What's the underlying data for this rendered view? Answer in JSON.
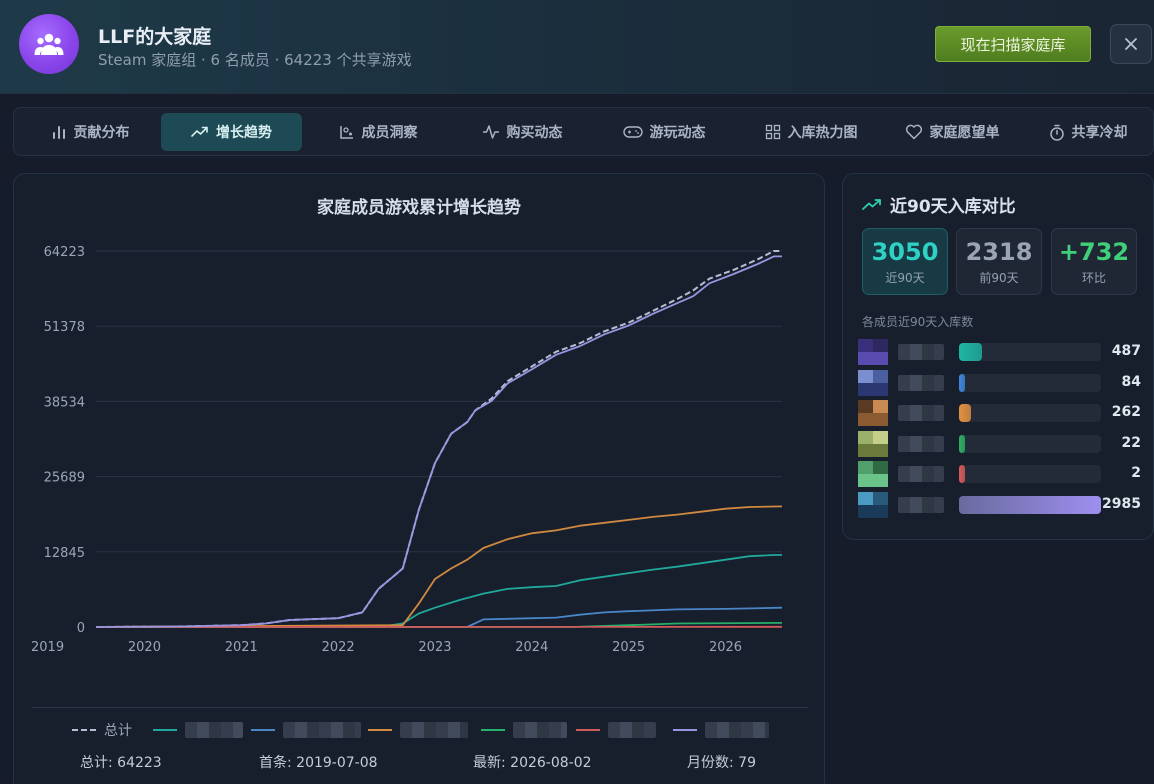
{
  "header": {
    "title": "LLF的大家庭",
    "subtitle": "Steam 家庭组 · 6 名成员 · 64223 个共享游戏",
    "scan_button": "现在扫描家庭库",
    "close_icon": "close-icon",
    "avatar_icon": "family-icon"
  },
  "tabs": [
    {
      "label": "贡献分布",
      "icon": "bar-chart-icon"
    },
    {
      "label": "增长趋势",
      "icon": "trend-up-icon",
      "active": true
    },
    {
      "label": "成员洞察",
      "icon": "scatter-chart-icon"
    },
    {
      "label": "购买动态",
      "icon": "activity-icon"
    },
    {
      "label": "游玩动态",
      "icon": "gamepad-icon"
    },
    {
      "label": "入库热力图",
      "icon": "grid-icon"
    },
    {
      "label": "家庭愿望单",
      "icon": "heart-icon"
    },
    {
      "label": "共享冷却",
      "icon": "timer-icon"
    }
  ],
  "chart": {
    "title": "家庭成员游戏累计增长趋势",
    "legend_total": "总计",
    "stats": {
      "total": "总计: 64223",
      "first": "首条: 2019-07-08",
      "latest": "最新: 2026-08-02",
      "months": "月份数: 79"
    }
  },
  "chart_data": {
    "type": "line",
    "title": "家庭成员游戏累计增长趋势",
    "xlabel": "",
    "ylabel": "",
    "x_ticks": [
      "2019",
      "2020",
      "2021",
      "2022",
      "2023",
      "2024",
      "2025",
      "2026"
    ],
    "y_ticks": [
      0,
      12845,
      25689,
      38534,
      51378,
      64223
    ],
    "xlim": [
      "2019-07",
      "2026-08"
    ],
    "ylim": [
      0,
      64223
    ],
    "grid": true,
    "legend_position": "bottom",
    "series": [
      {
        "name": "总计",
        "color": "#b8bdd6",
        "dashed": true,
        "points": [
          [
            "2019-07",
            0
          ],
          [
            "2020-06",
            100
          ],
          [
            "2021-01",
            300
          ],
          [
            "2021-04",
            600
          ],
          [
            "2021-07",
            1200
          ],
          [
            "2022-01",
            1500
          ],
          [
            "2022-04",
            2500
          ],
          [
            "2022-06",
            6500
          ],
          [
            "2022-09",
            10000
          ],
          [
            "2022-11",
            20000
          ],
          [
            "2023-01",
            28000
          ],
          [
            "2023-03",
            33000
          ],
          [
            "2023-05",
            35000
          ],
          [
            "2023-06",
            37000
          ],
          [
            "2023-08",
            39000
          ],
          [
            "2023-10",
            42000
          ],
          [
            "2024-01",
            44500
          ],
          [
            "2024-04",
            47000
          ],
          [
            "2024-07",
            48500
          ],
          [
            "2024-10",
            50500
          ],
          [
            "2025-01",
            52000
          ],
          [
            "2025-04",
            54000
          ],
          [
            "2025-07",
            56000
          ],
          [
            "2025-09",
            57500
          ],
          [
            "2025-11",
            59500
          ],
          [
            "2026-02",
            61000
          ],
          [
            "2026-05",
            62800
          ],
          [
            "2026-07",
            64223
          ],
          [
            "2026-08",
            64223
          ]
        ]
      },
      {
        "name": "",
        "color": "#1fa89b",
        "points": [
          [
            "2019-07",
            0
          ],
          [
            "2022-06",
            0
          ],
          [
            "2022-09",
            600
          ],
          [
            "2022-11",
            2300
          ],
          [
            "2023-01",
            3300
          ],
          [
            "2023-04",
            4600
          ],
          [
            "2023-07",
            5700
          ],
          [
            "2023-10",
            6500
          ],
          [
            "2024-01",
            6800
          ],
          [
            "2024-04",
            7000
          ],
          [
            "2024-07",
            8000
          ],
          [
            "2024-10",
            8600
          ],
          [
            "2025-01",
            9200
          ],
          [
            "2025-04",
            9800
          ],
          [
            "2025-07",
            10300
          ],
          [
            "2025-10",
            10900
          ],
          [
            "2026-01",
            11500
          ],
          [
            "2026-04",
            12100
          ],
          [
            "2026-07",
            12300
          ],
          [
            "2026-08",
            12300
          ]
        ]
      },
      {
        "name": "",
        "color": "#4a86c8",
        "points": [
          [
            "2019-07",
            0
          ],
          [
            "2023-05",
            0
          ],
          [
            "2023-07",
            1300
          ],
          [
            "2023-10",
            1400
          ],
          [
            "2024-04",
            1600
          ],
          [
            "2024-07",
            2100
          ],
          [
            "2024-10",
            2500
          ],
          [
            "2025-01",
            2700
          ],
          [
            "2025-07",
            3000
          ],
          [
            "2026-01",
            3100
          ],
          [
            "2026-08",
            3300
          ]
        ]
      },
      {
        "name": "",
        "color": "#d0893f",
        "points": [
          [
            "2019-07",
            0
          ],
          [
            "2022-09",
            300
          ],
          [
            "2022-11",
            4000
          ],
          [
            "2023-01",
            8200
          ],
          [
            "2023-03",
            10000
          ],
          [
            "2023-05",
            11500
          ],
          [
            "2023-07",
            13500
          ],
          [
            "2023-10",
            15000
          ],
          [
            "2024-01",
            16000
          ],
          [
            "2024-04",
            16500
          ],
          [
            "2024-07",
            17300
          ],
          [
            "2024-10",
            17800
          ],
          [
            "2025-01",
            18300
          ],
          [
            "2025-04",
            18800
          ],
          [
            "2025-07",
            19200
          ],
          [
            "2025-10",
            19700
          ],
          [
            "2026-01",
            20200
          ],
          [
            "2026-04",
            20500
          ],
          [
            "2026-08",
            20600
          ]
        ]
      },
      {
        "name": "",
        "color": "#27b06a",
        "points": [
          [
            "2019-07",
            0
          ],
          [
            "2024-06",
            0
          ],
          [
            "2025-01",
            300
          ],
          [
            "2025-07",
            600
          ],
          [
            "2026-08",
            700
          ]
        ]
      },
      {
        "name": "",
        "color": "#d05a5a",
        "points": [
          [
            "2019-07",
            0
          ],
          [
            "2026-08",
            40
          ]
        ]
      },
      {
        "name": "",
        "color": "#9a95e0",
        "points": [
          [
            "2019-07",
            0
          ],
          [
            "2020-06",
            100
          ],
          [
            "2021-01",
            300
          ],
          [
            "2021-04",
            600
          ],
          [
            "2021-07",
            1200
          ],
          [
            "2022-01",
            1500
          ],
          [
            "2022-04",
            2500
          ],
          [
            "2022-06",
            6500
          ],
          [
            "2022-09",
            10000
          ],
          [
            "2022-11",
            20000
          ],
          [
            "2023-01",
            28000
          ],
          [
            "2023-03",
            33000
          ],
          [
            "2023-05",
            35000
          ],
          [
            "2023-06",
            37000
          ],
          [
            "2023-08",
            38600
          ],
          [
            "2023-10",
            41600
          ],
          [
            "2024-01",
            44000
          ],
          [
            "2024-04",
            46500
          ],
          [
            "2024-07",
            48000
          ],
          [
            "2024-10",
            50000
          ],
          [
            "2025-01",
            51500
          ],
          [
            "2025-04",
            53500
          ],
          [
            "2025-07",
            55300
          ],
          [
            "2025-09",
            56500
          ],
          [
            "2025-11",
            58700
          ],
          [
            "2026-02",
            60300
          ],
          [
            "2026-05",
            62000
          ],
          [
            "2026-07",
            63300
          ],
          [
            "2026-08",
            63300
          ]
        ]
      }
    ]
  },
  "side": {
    "title": "近90天入库对比",
    "title_icon": "trend-up-icon",
    "kpis": [
      {
        "value": "3050",
        "label": "近90天",
        "color": "#2fd1c4"
      },
      {
        "value": "2318",
        "label": "前90天",
        "color": "#9aa5b4"
      },
      {
        "value": "+732",
        "label": "环比",
        "color": "#3fd17a"
      }
    ],
    "list_title": "各成员近90天入库数",
    "members": [
      {
        "value": 487,
        "label": "487",
        "color": "#1fb6a5",
        "avatar": [
          "#3a2f7a",
          "#2d2860",
          "#5a4bb0",
          "#3b3390"
        ]
      },
      {
        "value": 84,
        "label": "84",
        "color": "#3f86dd",
        "avatar": [
          "#7b8fd0",
          "#4a5fa0",
          "#2b3770",
          "#5d6ab8"
        ]
      },
      {
        "value": 262,
        "label": "262",
        "color": "#e3923f",
        "avatar": [
          "#5a3a22",
          "#c98a52",
          "#8a5a30",
          "#3a2a1e"
        ]
      },
      {
        "value": 22,
        "label": "22",
        "color": "#2fae62",
        "avatar": [
          "#9bb06a",
          "#c4d08a",
          "#6a7a3a",
          "#4a5a2a"
        ]
      },
      {
        "value": 2,
        "label": "2",
        "color": "#d65a5a",
        "avatar": [
          "#4fa06a",
          "#2f6a44",
          "#6ac48a",
          "#3a7a50"
        ]
      },
      {
        "value": 2985,
        "label": "2985",
        "color": "#9d8ff0",
        "avatar": [
          "#4a9ac4",
          "#2a5a7a",
          "#1a3a5a",
          "#6abedc"
        ]
      }
    ]
  }
}
